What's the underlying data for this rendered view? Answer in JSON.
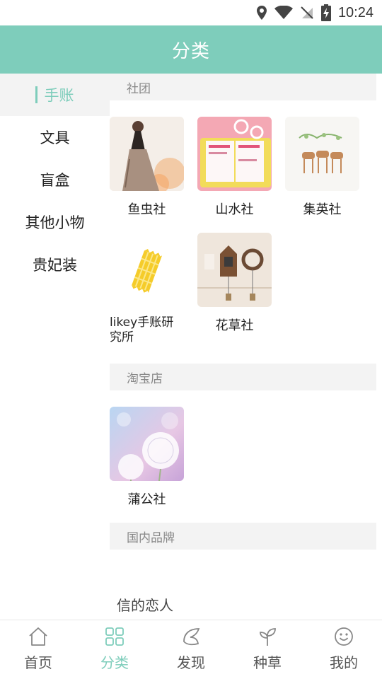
{
  "status": {
    "time": "10:24"
  },
  "header": {
    "title": "分类"
  },
  "sidebar": {
    "items": [
      {
        "label": "手账",
        "active": true
      },
      {
        "label": "文具"
      },
      {
        "label": "盲盒"
      },
      {
        "label": "其他小物"
      },
      {
        "label": "贵妃装"
      }
    ]
  },
  "sections": [
    {
      "title": "社团",
      "items": [
        {
          "name": "鱼虫社"
        },
        {
          "name": "山水社"
        },
        {
          "name": "集英社"
        },
        {
          "name": "likey手账研究所"
        },
        {
          "name": "花草社"
        }
      ]
    },
    {
      "title": "淘宝店",
      "items": [
        {
          "name": "蒲公社"
        }
      ]
    },
    {
      "title": "国内品牌",
      "items": [
        {
          "name": "信的恋人"
        }
      ]
    }
  ],
  "tabbar": {
    "tabs": [
      {
        "label": "首页",
        "icon": "home-icon"
      },
      {
        "label": "分类",
        "icon": "grid-icon",
        "active": true
      },
      {
        "label": "发现",
        "icon": "discover-icon"
      },
      {
        "label": "种草",
        "icon": "sprout-icon"
      },
      {
        "label": "我的",
        "icon": "smiley-icon"
      }
    ]
  },
  "colors": {
    "accent": "#7ecdbb",
    "section_bg": "#f3f3f3"
  }
}
